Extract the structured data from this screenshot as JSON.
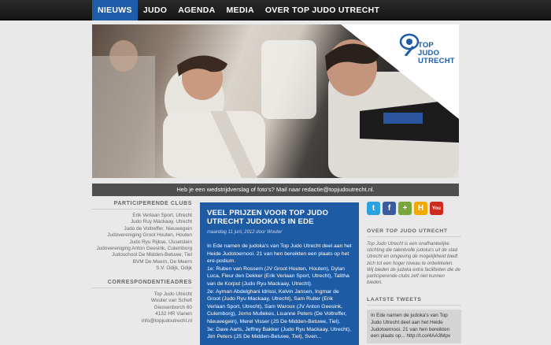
{
  "nav": {
    "items": [
      "NIEUWS",
      "JUDO",
      "AGENDA",
      "MEDIA",
      "OVER TOP JUDO UTRECHT"
    ]
  },
  "logo": {
    "line1": "TOP",
    "line2": "JUDO",
    "line3": "UTRECHT"
  },
  "notice": "Heb je een wedstrijdverslag of foto's? Mail naar redactie@topjudoutrecht.nl.",
  "left": {
    "clubs_title": "PARTICIPERENDE CLUBS",
    "clubs": [
      "Erik Verlaan Sport, Utrecht",
      "Judo Ruy Mackaay, Utrecht",
      "Judo de Voltreffer, Nieuwegein",
      "Judovereniging Groot Houten, Houten",
      "Judo Ryu Rijkse, IJsselstein",
      "Judovereniging Anton Geesink, Culemborg",
      "Judoschool De Midden-Betuwe, Tiel",
      "BVM De Meern, De Meern",
      "S.V. Odijk, Odijk"
    ],
    "contact_title": "CORRESPONDENTIEADRES",
    "contact": [
      "Top Judo Utrecht",
      "Wouter van Schelt",
      "Giessenborch 60",
      "4132 HR Vianen",
      "info@topjudoutrecht.nl"
    ]
  },
  "article": {
    "title": "VEEL PRIJZEN VOOR TOP JUDO UTRECHT JUDOKA'S IN EDE",
    "meta": "maandag 11 juni, 2012 door Wouter",
    "paragraphs": [
      "In Ede namen de judoka's van Top Judo Utrecht deel aan het Heide Judotoernooi. 21 van hen bereikten een plaats op het ere-podium.",
      "1e: Ruben van Rossem (JV Groot Houten, Houten), Dylan Luca, Fleur den Dekker (Erik Verlaan Sport, Utrecht), Talitha van de Korput (Judo Ryu Mackaay, Utrecht).",
      "2e: Ayman Abdelghani Idrissi, Kelvin Jansen, Ingmar de Groot (Judo Ryu Mackaay, Utrecht), Sam Ruiter (Erik Verlaan Sport, Utrecht), Sam Waroux (JV Anton Geesink, Culemborg), Jorno Mullekes, Lisanne Peters (De Voltreffer, Nieuwegein), Merel Visser (JS De Midden-Betuwe, Tiel).",
      "3e: Dave Aarts, Jeffrey Bakker (Judo Ryu Mackaay, Utrecht), Jim Peters (JS De Midden-Betuwe, Tiel), Sven..."
    ]
  },
  "right": {
    "social": [
      {
        "icon": "twitter-icon",
        "glyph": "t",
        "color": "#2aa3e0"
      },
      {
        "icon": "facebook-icon",
        "glyph": "f",
        "color": "#3b5b9a"
      },
      {
        "icon": "google-plus-icon",
        "glyph": "+",
        "color": "#7aa53a"
      },
      {
        "icon": "hyves-icon",
        "glyph": "H",
        "color": "#f2a900"
      },
      {
        "icon": "youtube-icon",
        "glyph": "You",
        "color": "#cc2b1e"
      }
    ],
    "about_title": "OVER TOP JUDO UTRECHT",
    "about_text": "Top Judo Utrecht is een onafhankelijke stichting die talentvolle judoka's uit de stad Utrecht en omgeving de mogelijkheid biedt zich tot een hoger niveau te ontwikkelen. Wij bieden de judoka extra faciliteiten die de participerende clubs zelf niet kunnen bieden.",
    "tweets_title": "LAATSTE TWEETS",
    "tweet": "In Ede namen de judoka's van Top Judo Utrecht deel aan het Heide Judotoernooi. 21 van hen bereikten een plaats op... http://t.co/4AA3Mpv"
  }
}
